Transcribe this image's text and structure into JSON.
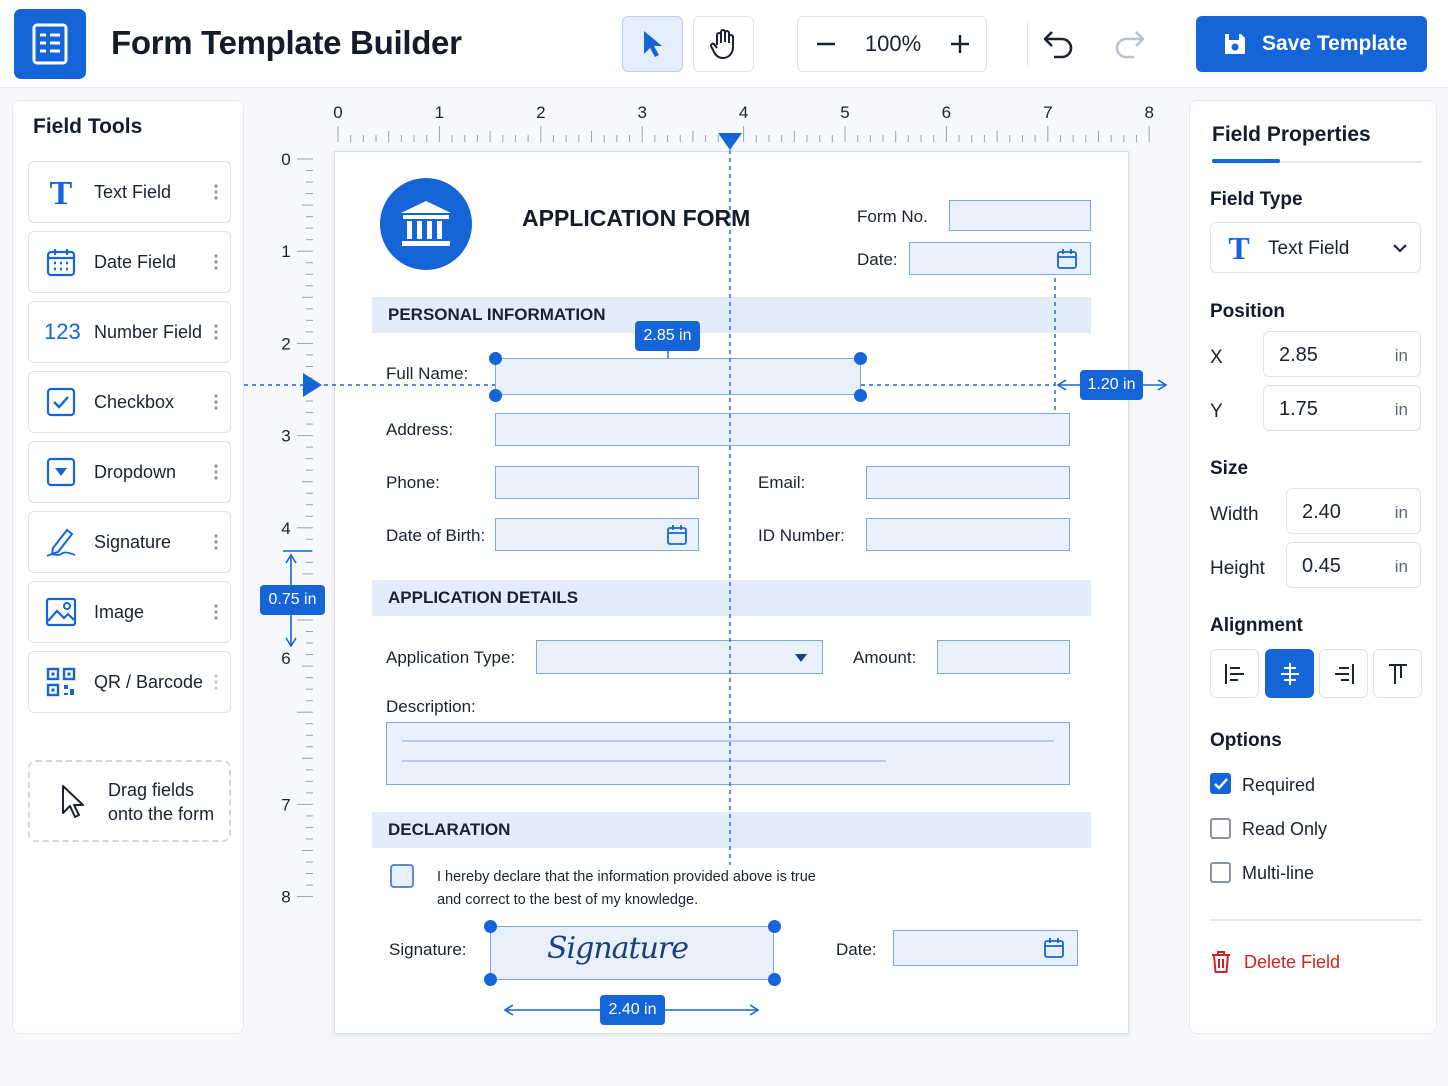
{
  "header": {
    "title": "Form Template Builder",
    "zoom": "100%",
    "save_label": "Save Template",
    "icons": [
      "form-icon",
      "select-tool-icon",
      "pan-tool-icon",
      "zoom-out-icon",
      "zoom-in-icon",
      "undo-icon",
      "redo-icon",
      "save-icon"
    ]
  },
  "tools": {
    "title": "Field Tools",
    "items": [
      {
        "label": "Text Field",
        "icon": "text-icon"
      },
      {
        "label": "Date Field",
        "icon": "calendar-icon"
      },
      {
        "label": "Number Field",
        "icon": "number-icon",
        "glyph": "123"
      },
      {
        "label": "Checkbox",
        "icon": "checkbox-icon"
      },
      {
        "label": "Dropdown",
        "icon": "dropdown-icon"
      },
      {
        "label": "Signature",
        "icon": "signature-icon"
      },
      {
        "label": "Image",
        "icon": "image-icon"
      },
      {
        "label": "QR / Barcode",
        "icon": "qr-icon"
      }
    ],
    "drag_hint_line1": "Drag fields",
    "drag_hint_line2": "onto the form"
  },
  "ruler": {
    "top_ticks": [
      "0",
      "1",
      "2",
      "3",
      "4",
      "5",
      "6",
      "7",
      "8"
    ],
    "left_ticks": [
      "0",
      "1",
      "2",
      "3",
      "4",
      "6",
      "7",
      "8"
    ]
  },
  "form": {
    "title": "APPLICATION FORM",
    "form_no_label": "Form No.",
    "date_label": "Date:",
    "sections": {
      "personal": "PERSONAL INFORMATION",
      "application": "APPLICATION DETAILS",
      "declaration": "DECLARATION"
    },
    "labels": {
      "full_name": "Full Name:",
      "address": "Address:",
      "phone": "Phone:",
      "email": "Email:",
      "dob": "Date of Birth:",
      "id_number": "ID Number:",
      "application_type": "Application Type:",
      "amount": "Amount:",
      "description": "Description:",
      "signature": "Signature:",
      "sig_date": "Date:"
    },
    "declaration_line1": "I hereby declare that the information provided above is true",
    "declaration_line2": "and correct to the best of my knowledge.",
    "signature_text": "Signature"
  },
  "measurements": {
    "x_tag": "2.85 in",
    "right_tag": "1.20 in",
    "left_tag": "0.75 in",
    "width_tag": "2.40 in"
  },
  "properties": {
    "title": "Field Properties",
    "field_type_heading": "Field Type",
    "field_type_value": "Text Field",
    "position_heading": "Position",
    "x_label": "X",
    "x_value": "2.85",
    "y_label": "Y",
    "y_value": "1.75",
    "size_heading": "Size",
    "width_label": "Width",
    "width_value": "2.40",
    "height_label": "Height",
    "height_value": "0.45",
    "unit": "in",
    "alignment_heading": "Alignment",
    "alignment_selected": "center",
    "options_heading": "Options",
    "options": [
      {
        "label": "Required",
        "checked": true
      },
      {
        "label": "Read Only",
        "checked": false
      },
      {
        "label": "Multi-line",
        "checked": false
      }
    ],
    "delete_label": "Delete Field"
  },
  "colors": {
    "accent": "#1565d8",
    "field_fill": "#e8f0fb",
    "section_fill": "#e3ecf9",
    "danger": "#d32222"
  }
}
